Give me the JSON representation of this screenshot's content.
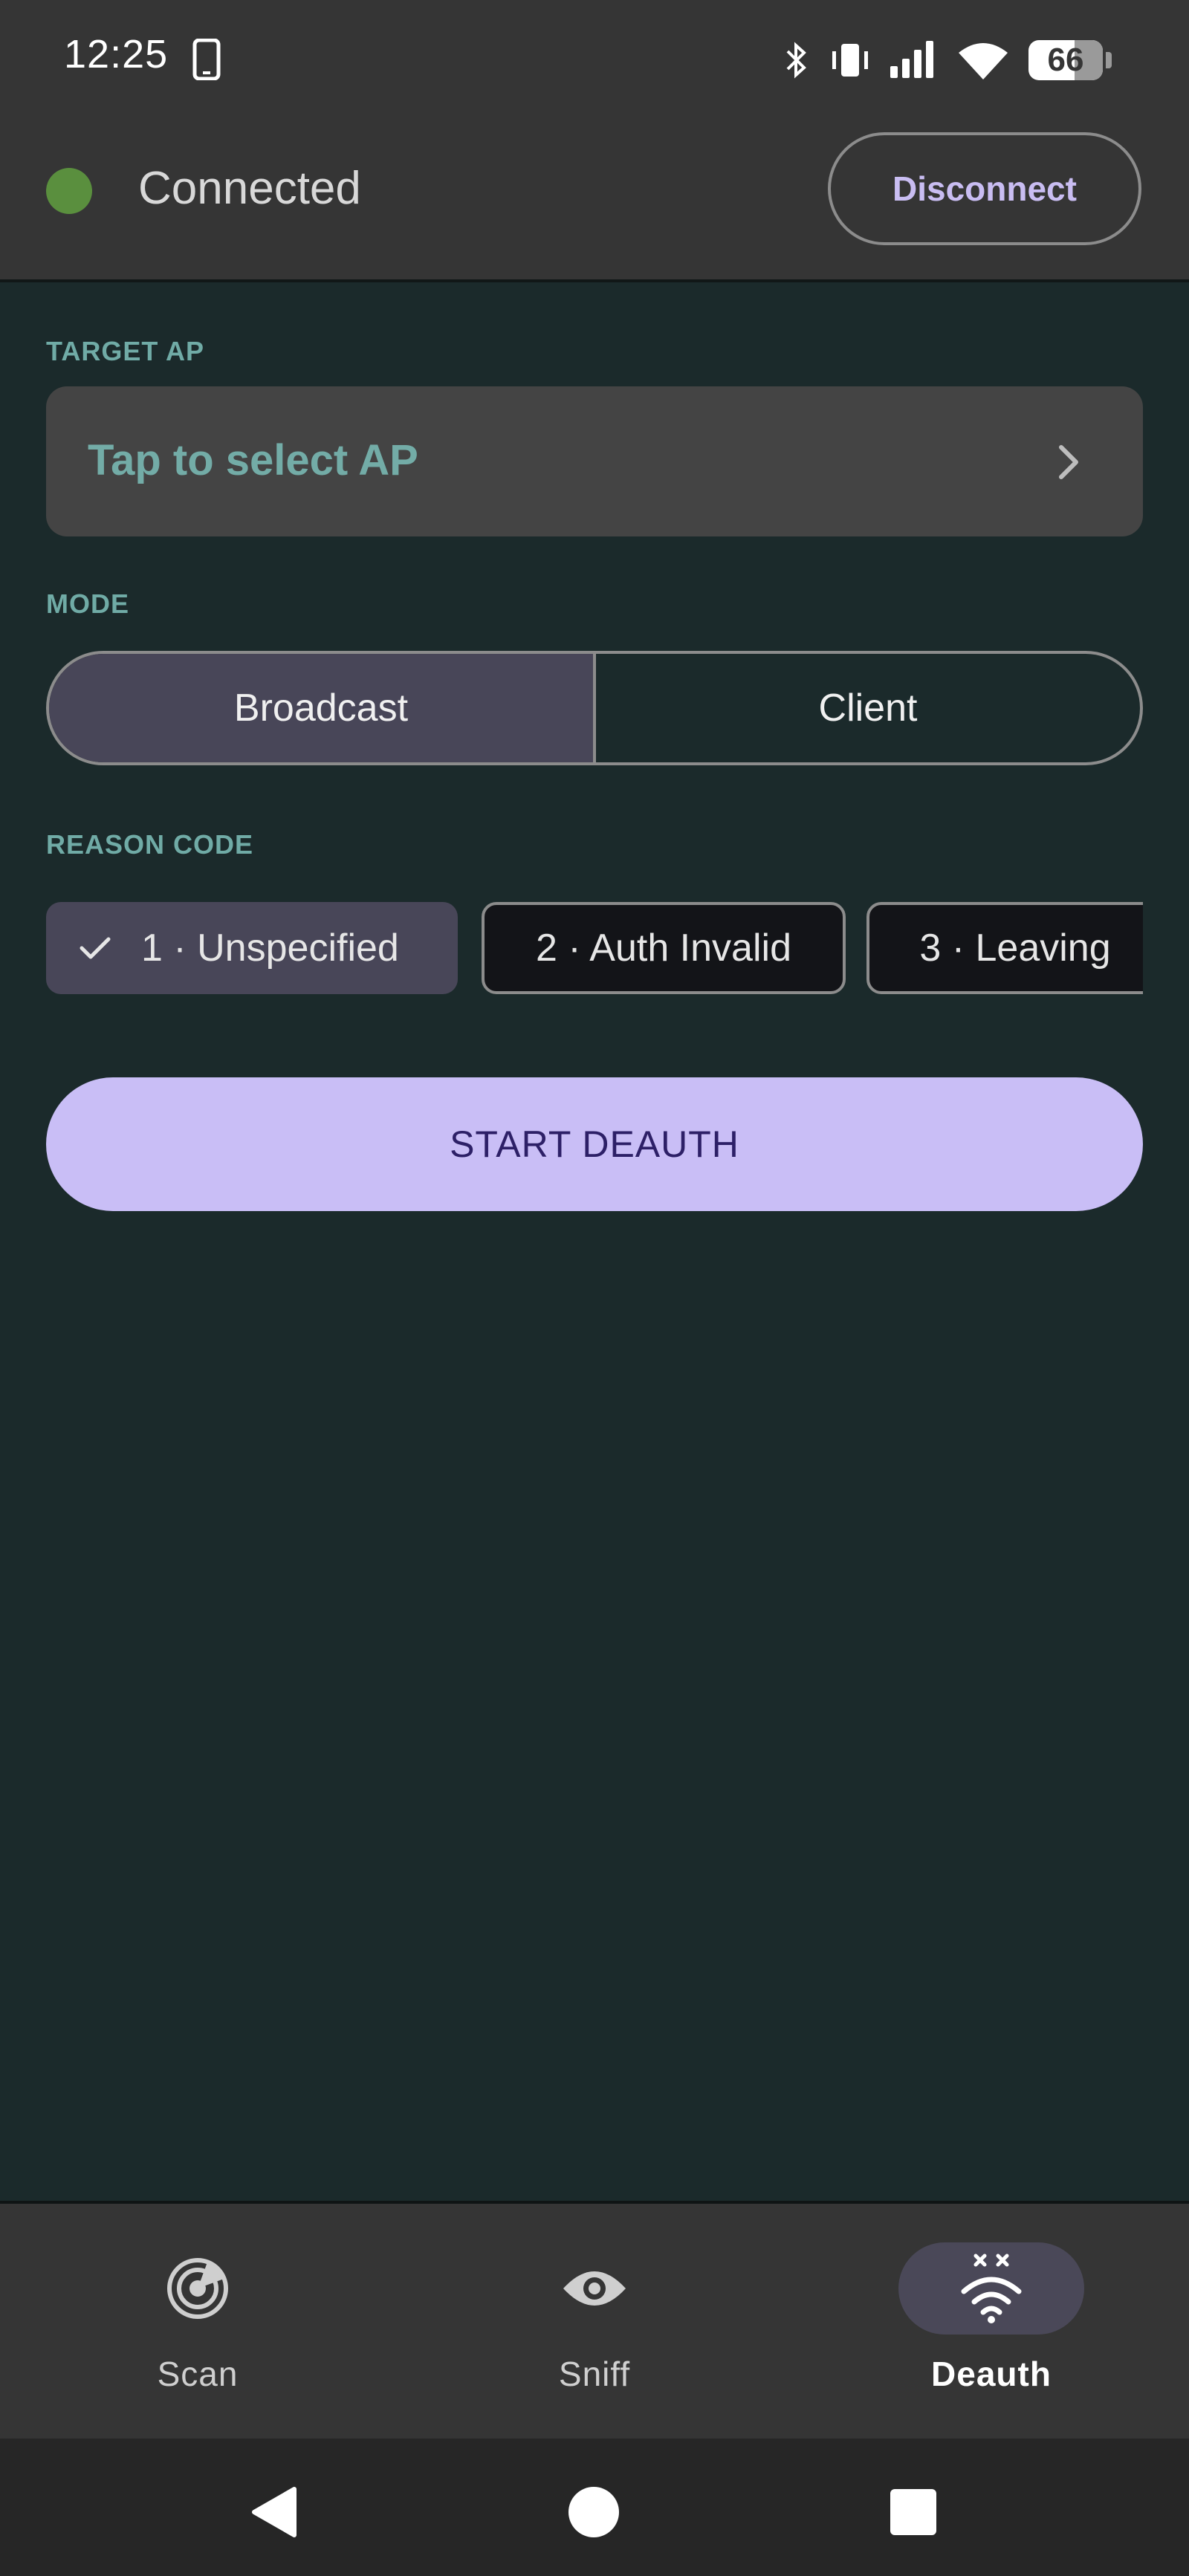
{
  "status_bar": {
    "time": "12:25",
    "battery": "66",
    "icons": [
      "phone-icon",
      "bluetooth-icon",
      "vibrate-icon",
      "signal-icon",
      "wifi-icon",
      "battery-icon"
    ]
  },
  "connection": {
    "status": "Connected",
    "status_color": "#5a8f3e",
    "disconnect_label": "Disconnect"
  },
  "target": {
    "label": "TARGET AP",
    "placeholder": "Tap to select AP"
  },
  "mode": {
    "label": "MODE",
    "options": [
      "Broadcast",
      "Client"
    ],
    "selected": "Broadcast"
  },
  "reason": {
    "label": "REASON CODE",
    "chips": [
      "1 · Unspecified",
      "2 · Auth Invalid",
      "3 · Leaving"
    ],
    "selected": "1 · Unspecified"
  },
  "action": {
    "start_label": "START DEAUTH"
  },
  "bottom_nav": {
    "items": [
      {
        "label": "Scan",
        "icon": "radar-icon"
      },
      {
        "label": "Sniff",
        "icon": "eye-icon"
      },
      {
        "label": "Deauth",
        "icon": "wifi-off-icon"
      }
    ],
    "active": "Deauth"
  },
  "colors": {
    "accent": "#c9bef6",
    "label_teal": "#70aba6",
    "background": "#1b2a2b"
  }
}
